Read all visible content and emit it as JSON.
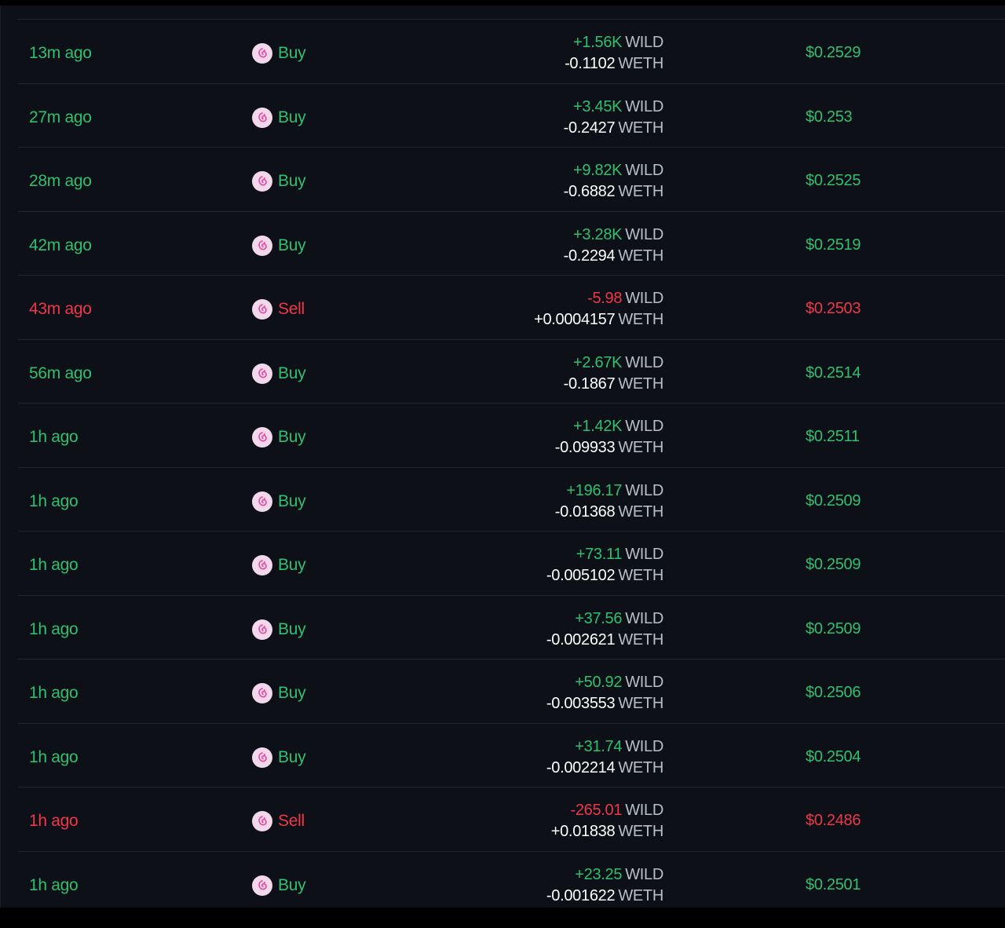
{
  "colors": {
    "buy": "#2fbf71",
    "sell": "#f0364a",
    "background": "#0d1117"
  },
  "dex_icon": "uniswap-icon",
  "trades": [
    {
      "time": "13m ago",
      "side": "Buy",
      "token_amount": "+1.56K",
      "token_unit": "WILD",
      "base_amount": "-0.1102",
      "base_unit": "WETH",
      "price": "$0.2529"
    },
    {
      "time": "27m ago",
      "side": "Buy",
      "token_amount": "+3.45K",
      "token_unit": "WILD",
      "base_amount": "-0.2427",
      "base_unit": "WETH",
      "price": "$0.253"
    },
    {
      "time": "28m ago",
      "side": "Buy",
      "token_amount": "+9.82K",
      "token_unit": "WILD",
      "base_amount": "-0.6882",
      "base_unit": "WETH",
      "price": "$0.2525"
    },
    {
      "time": "42m ago",
      "side": "Buy",
      "token_amount": "+3.28K",
      "token_unit": "WILD",
      "base_amount": "-0.2294",
      "base_unit": "WETH",
      "price": "$0.2519"
    },
    {
      "time": "43m ago",
      "side": "Sell",
      "token_amount": "-5.98",
      "token_unit": "WILD",
      "base_amount": "+0.0004157",
      "base_unit": "WETH",
      "price": "$0.2503"
    },
    {
      "time": "56m ago",
      "side": "Buy",
      "token_amount": "+2.67K",
      "token_unit": "WILD",
      "base_amount": "-0.1867",
      "base_unit": "WETH",
      "price": "$0.2514"
    },
    {
      "time": "1h ago",
      "side": "Buy",
      "token_amount": "+1.42K",
      "token_unit": "WILD",
      "base_amount": "-0.09933",
      "base_unit": "WETH",
      "price": "$0.2511"
    },
    {
      "time": "1h ago",
      "side": "Buy",
      "token_amount": "+196.17",
      "token_unit": "WILD",
      "base_amount": "-0.01368",
      "base_unit": "WETH",
      "price": "$0.2509"
    },
    {
      "time": "1h ago",
      "side": "Buy",
      "token_amount": "+73.11",
      "token_unit": "WILD",
      "base_amount": "-0.005102",
      "base_unit": "WETH",
      "price": "$0.2509"
    },
    {
      "time": "1h ago",
      "side": "Buy",
      "token_amount": "+37.56",
      "token_unit": "WILD",
      "base_amount": "-0.002621",
      "base_unit": "WETH",
      "price": "$0.2509"
    },
    {
      "time": "1h ago",
      "side": "Buy",
      "token_amount": "+50.92",
      "token_unit": "WILD",
      "base_amount": "-0.003553",
      "base_unit": "WETH",
      "price": "$0.2506"
    },
    {
      "time": "1h ago",
      "side": "Buy",
      "token_amount": "+31.74",
      "token_unit": "WILD",
      "base_amount": "-0.002214",
      "base_unit": "WETH",
      "price": "$0.2504"
    },
    {
      "time": "1h ago",
      "side": "Sell",
      "token_amount": "-265.01",
      "token_unit": "WILD",
      "base_amount": "+0.01838",
      "base_unit": "WETH",
      "price": "$0.2486"
    },
    {
      "time": "1h ago",
      "side": "Buy",
      "token_amount": "+23.25",
      "token_unit": "WILD",
      "base_amount": "-0.001622",
      "base_unit": "WETH",
      "price": "$0.2501"
    }
  ]
}
